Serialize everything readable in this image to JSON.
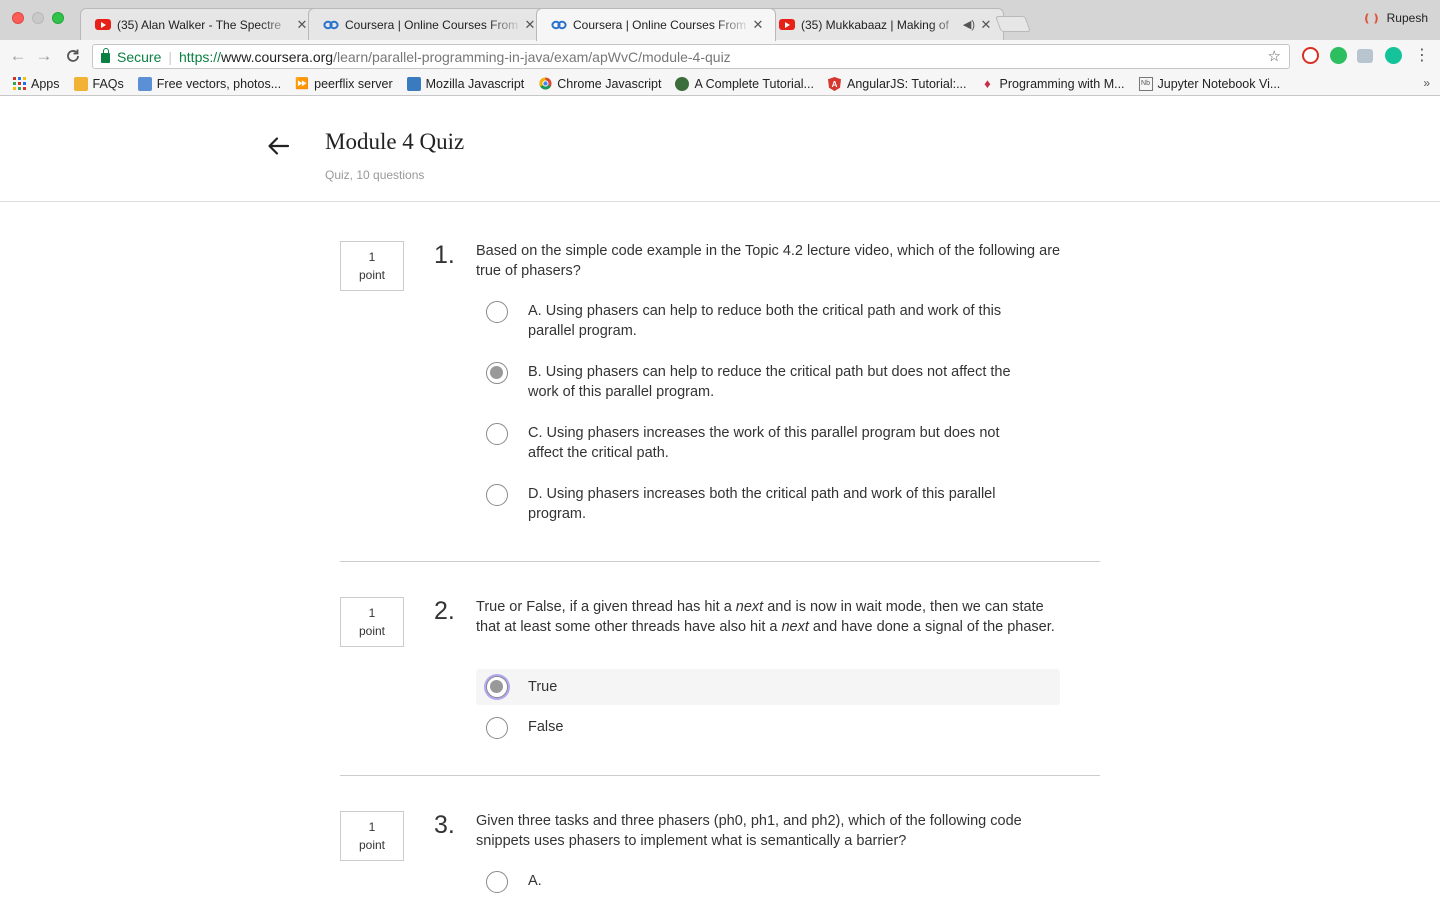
{
  "browser": {
    "tabs": [
      {
        "title": "(35) Alan Walker - The Spectre",
        "favicon": "youtube-icon"
      },
      {
        "title": "Coursera | Online Courses From",
        "favicon": "coursera-icon"
      },
      {
        "title": "Coursera | Online Courses From",
        "favicon": "coursera-icon"
      },
      {
        "title": "(35) Mukkabaaz | Making of",
        "favicon": "youtube-icon"
      }
    ],
    "profile_name": "Rupesh",
    "secure_label": "Secure",
    "url_scheme": "https://",
    "url_host": "www.coursera.org",
    "url_path": "/learn/parallel-programming-in-java/exam/apWvC/module-4-quiz",
    "bookmarks": [
      {
        "label": "Apps",
        "icon": "apps-grid-icon"
      },
      {
        "label": "FAQs",
        "icon": "box-icon"
      },
      {
        "label": "Free vectors, photos...",
        "icon": "image-icon"
      },
      {
        "label": "peerflix server",
        "icon": "fast-forward-icon"
      },
      {
        "label": "Mozilla Javascript",
        "icon": "mozilla-icon"
      },
      {
        "label": "Chrome Javascript",
        "icon": "chrome-icon"
      },
      {
        "label": "A Complete Tutorial...",
        "icon": "globe-icon"
      },
      {
        "label": "AngularJS: Tutorial:...",
        "icon": "angular-icon"
      },
      {
        "label": "Programming with M...",
        "icon": "gem-icon"
      },
      {
        "label": "Jupyter Notebook Vi...",
        "icon": "notebook-icon"
      }
    ],
    "bookmarks_more": "»"
  },
  "header": {
    "title": "Module 4 Quiz",
    "subtitle": "Quiz, 10 questions"
  },
  "questions": [
    {
      "number": "1.",
      "points_value": "1",
      "points_unit": "point",
      "text": "Based on the simple code example in the Topic 4.2 lecture video, which of the following are true of phasers?",
      "options": [
        {
          "label": "A. Using phasers can help to reduce both the critical path and work of this parallel program.",
          "checked": false
        },
        {
          "label": "B. Using phasers can help to reduce the critical path but does not affect the work of this parallel program.",
          "checked": true
        },
        {
          "label": "C. Using phasers increases the work of this parallel program but does not affect the critical path.",
          "checked": false
        },
        {
          "label": "D. Using phasers increases both the critical path and work of this parallel program.",
          "checked": false
        }
      ]
    },
    {
      "number": "2.",
      "points_value": "1",
      "points_unit": "point",
      "text_parts": [
        "True or False, if a given thread has hit a ",
        "next",
        " and is now in wait mode, then we can state that at least some other threads have also hit a ",
        "next",
        " and have done a signal of the phaser."
      ],
      "options": [
        {
          "label": "True",
          "checked": true
        },
        {
          "label": "False",
          "checked": false
        }
      ]
    },
    {
      "number": "3.",
      "points_value": "1",
      "points_unit": "point",
      "text": "Given three tasks and three phasers (ph0, ph1, and ph2), which of the following code snippets uses phasers to implement what is semantically a barrier?",
      "options": [
        {
          "label": "A.",
          "checked": false
        }
      ]
    }
  ]
}
